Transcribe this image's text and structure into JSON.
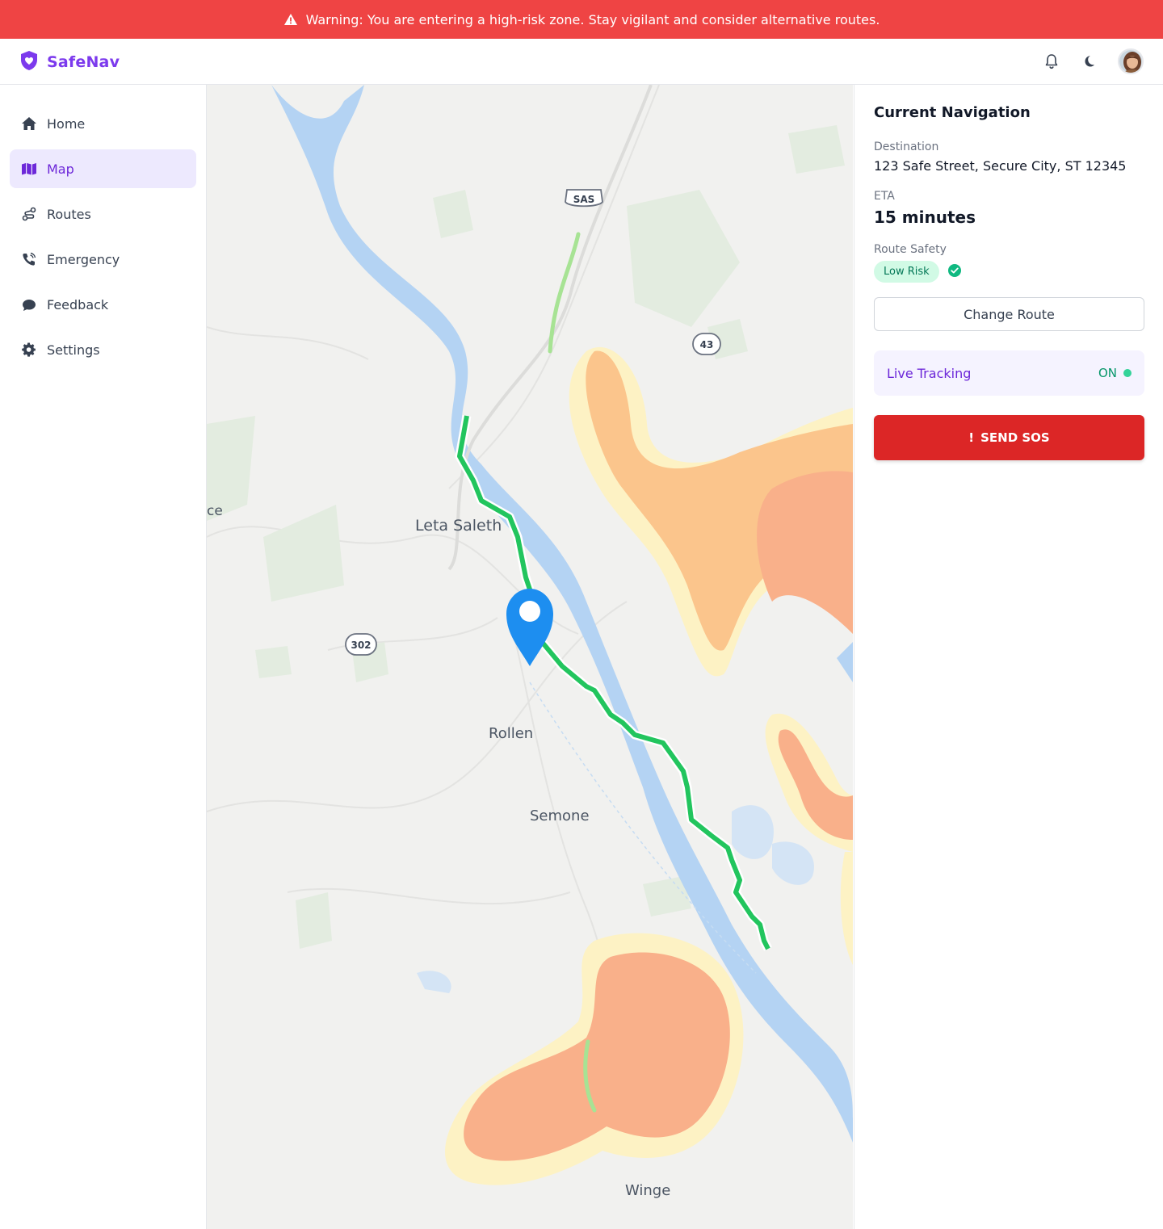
{
  "warning": {
    "text": "Warning: You are entering a high-risk zone. Stay vigilant and consider alternative routes.",
    "icon": "warning-triangle-icon",
    "color": "#ef4444"
  },
  "brand": {
    "name": "SafeNav",
    "icon": "shield-heart-icon",
    "color": "#7c3aed"
  },
  "header": {
    "notification_icon": "bell-icon",
    "theme_icon": "moon-icon",
    "avatar_icon": "user-avatar"
  },
  "sidebar": {
    "items": [
      {
        "label": "Home",
        "icon": "home-icon",
        "active": false
      },
      {
        "label": "Map",
        "icon": "map-icon",
        "active": true
      },
      {
        "label": "Routes",
        "icon": "route-icon",
        "active": false
      },
      {
        "label": "Emergency",
        "icon": "phone-icon",
        "active": false
      },
      {
        "label": "Feedback",
        "icon": "chat-icon",
        "active": false
      },
      {
        "label": "Settings",
        "icon": "gear-icon",
        "active": false
      }
    ]
  },
  "map": {
    "places": [
      "Leta Saleth",
      "Rollen",
      "Semone",
      "Winge",
      "ce"
    ],
    "road_shields": [
      "SAS",
      "43",
      "302"
    ],
    "route_color": "#22c55e",
    "risk_zone_color": "#fdba74",
    "marker_icon": "location-pin-icon"
  },
  "panel": {
    "title": "Current Navigation",
    "destination_label": "Destination",
    "destination": "123 Safe Street, Secure City, ST 12345",
    "eta_label": "ETA",
    "eta": "15 minutes",
    "safety_label": "Route Safety",
    "safety_badge": "Low Risk",
    "change_route": "Change Route",
    "tracking_label": "Live Tracking",
    "tracking_status": "ON",
    "sos_label": "SEND SOS",
    "sos_icon": "!"
  }
}
